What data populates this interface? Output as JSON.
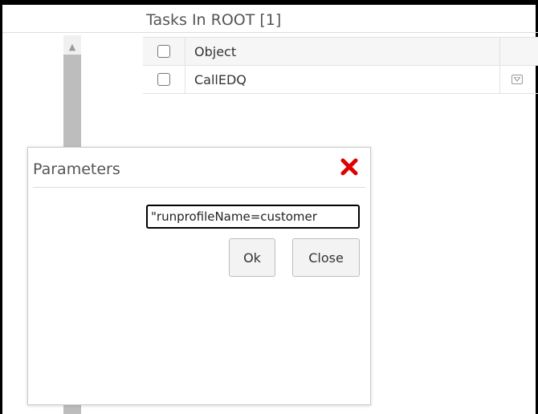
{
  "tasks_panel": {
    "title": "Tasks In ROOT [1]",
    "columns": [
      "Object"
    ],
    "rows": [
      {
        "object": "CallEDQ"
      }
    ]
  },
  "dialog": {
    "title": "Parameters",
    "close_icon": "close-x-icon",
    "close_icon_color": "#e00000",
    "input_value": "\"runprofileName=customer",
    "ok_label": "Ok",
    "close_label": "Close"
  },
  "icons": {
    "row_menu": "dropdown-menu-icon",
    "scroll_up": "scroll-up-arrow-icon"
  }
}
